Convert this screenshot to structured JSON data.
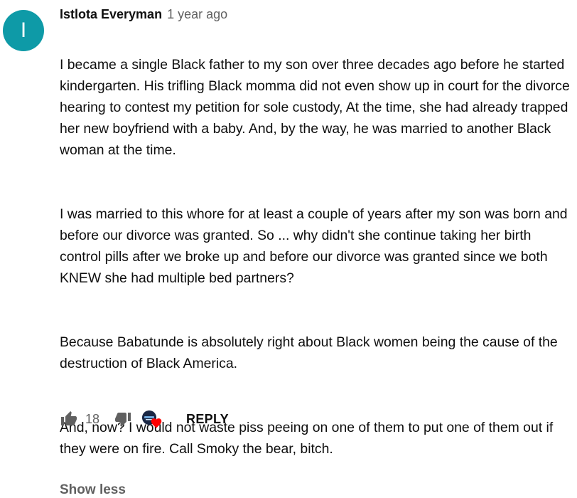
{
  "comment": {
    "avatar_letter": "I",
    "author": "Istlota Everyman",
    "time": "1 year ago",
    "paragraphs": [
      "I became a single Black father to my son over three decades ago before he started kindergarten. His trifling Black momma did not even show up in court for the divorce hearing to contest my petition for sole custody, At the time, she had already trapped her new boyfriend with a baby. And, by the way, he was married to another Black woman at the time.",
      "I was married to this whore for at least a couple of years after my son was born and before our divorce was granted. So ... why didn't she continue taking her birth control pills after we broke up and before our divorce was granted since we both KNEW she had multiple bed partners?",
      "Because Babatunde is absolutely right about Black women being the cause of the destruction of Black America.",
      "And, now?  I would not waste piss peeing on one of them to put one of them out if they were on fire. Call Smoky the bear, bitch."
    ],
    "show_less": "Show less",
    "like_count": "18",
    "reply_label": "REPLY"
  },
  "icons": {
    "like": "thumbs-up-icon",
    "dislike": "thumbs-down-icon",
    "creator_heart": "heart-icon"
  },
  "colors": {
    "avatar_bg": "#0e9aa7",
    "heart": "#ff0000",
    "secondary_text": "#606060"
  }
}
